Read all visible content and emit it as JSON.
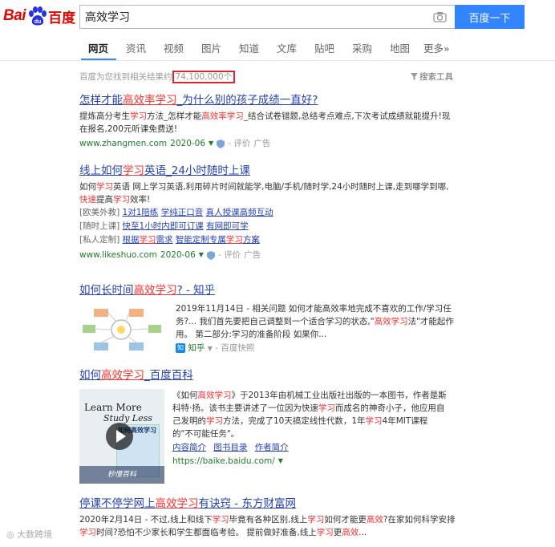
{
  "header": {
    "logo_bai": "Bai",
    "logo_cn": "百度",
    "query": "高效学习",
    "search_button": "百度一下"
  },
  "tabs": [
    {
      "label": "网页"
    },
    {
      "label": "资讯"
    },
    {
      "label": "视频"
    },
    {
      "label": "图片"
    },
    {
      "label": "知道"
    },
    {
      "label": "文库"
    },
    {
      "label": "贴吧"
    },
    {
      "label": "采购"
    },
    {
      "label": "地图"
    },
    {
      "label": "更多»"
    }
  ],
  "stats": {
    "prefix": "百度为您找到相关结果约",
    "count": "74,100,000个",
    "tools": "搜索工具"
  },
  "results": [
    {
      "title_a": "怎样才能",
      "title_em": "高效率学习",
      "title_b": "_为什么别的孩子成绩一直好?",
      "snip_a": "提炼高分考生",
      "snip_em1": "学习",
      "snip_b": "方法_怎样才能",
      "snip_em2": "高效率学习",
      "snip_c": "_结合试卷错题,总结考点难点,下次考试成绩就能提升!现在报名,200元听课免费送!",
      "url": "www.zhangmen.com",
      "date": "2020-06",
      "rating": "- 评价",
      "ad": "广告"
    },
    {
      "title_a": "线上如何",
      "title_em": "学习",
      "title_b": "英语_24小时随时上课",
      "snip_a": "如何",
      "snip_em1": "学习",
      "snip_b": "英语 网上学习英语,利用碎片时间就能学,电脑/手机/随时学,24小时随时上课,走到哪学到哪,",
      "snip_em2": "快速",
      "snip_c": "提高",
      "snip_em3": "学习",
      "snip_d": "效率!",
      "sub1_tag": "[欧美外教]",
      "sub1_links": [
        "1对1陪练",
        "学纯正口音",
        "真人授课高频互动"
      ],
      "sub2_tag": "[随时上课]",
      "sub2_links": [
        "快至1小时内即可订课",
        "有网即可学"
      ],
      "sub3_tag": "[私人定制]",
      "sub3_link1_a": "根据",
      "sub3_link1_em": "学习",
      "sub3_link1_b": "需求",
      "sub3_link2_a": "智能定制专属",
      "sub3_link2_em": "学习",
      "sub3_link2_b": "方案",
      "url": "www.likeshuo.com",
      "date": "2020-06",
      "rating": "- 评价",
      "ad": "广告"
    },
    {
      "title_a": "如何长时间",
      "title_em": "高效学习",
      "title_b": "? - 知乎",
      "text_a": "2019年11月14日 - 相关问题 如何才能高效率地完成不喜欢的工作/学习任务?... 我们首先要把自己调整到一个适合学习的状态,\"",
      "text_em": "高效学习",
      "text_b": "法\"才能起作用。 第二部分:学习的准备阶段 如果你...",
      "source": "知乎",
      "snapshot": "- 百度快照"
    },
    {
      "title_a": "如何",
      "title_em": "高效学习",
      "title_b": "_百度百科",
      "text_a": "《如何",
      "text_em1": "高效学习",
      "text_b": "》于2013年由机械工业出版社出版的一本图书，作者是斯科特·扬。该书主要讲述了一位因为快速",
      "text_em2": "学习",
      "text_c": "而成名的神奇小子，他应用自己发明的",
      "text_em3": "学习",
      "text_d": "方法，完成了10天搞定线性代数，1年",
      "text_em4": "学习",
      "text_e": "4年MIT课程的\"不可能任务\"。",
      "links": [
        "内容简介",
        "图书目录",
        "作者简介"
      ],
      "url": "https://baike.baidu.com/",
      "book_line1": "Learn More",
      "book_line2": "Study Less",
      "book_cover_title": "如何高效学习",
      "book_banner": "秒懂百科"
    },
    {
      "title_a": "停课不停学网上",
      "title_em": "高效学习",
      "title_b": "有诀窍 - 东方财富网",
      "snip_a": "2020年2月14日 - 不过,线上和线下",
      "snip_em1": "学习",
      "snip_b": "毕竟有各种区别,线上",
      "snip_em2": "学习",
      "snip_c": "如何才能更",
      "snip_em3": "高效",
      "snip_d": "?在家如何科学安排",
      "snip_em4": "学习",
      "snip_e": "时间?恐怕不少家长和学生都面临考验。 提前做好准备,线上",
      "snip_em5": "学习",
      "snip_f": "更",
      "snip_em6": "高效",
      "snip_g": "..."
    }
  ],
  "watermark": "大数跨境",
  "colors": {
    "accent_blue": "#3385ff",
    "link_blue": "#2440b3",
    "highlight_red": "#f73131",
    "url_green": "#1e7c2c",
    "stats_box_red": "#d9272e"
  }
}
